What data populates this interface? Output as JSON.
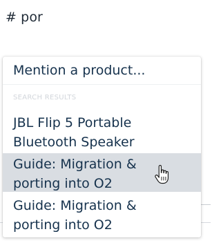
{
  "editor": {
    "text": "# por"
  },
  "dropdown": {
    "mention_label": "Mention a product...",
    "section_header": "SEARCH RESULTS",
    "results": [
      {
        "line1": "JBL Flip 5 Portable",
        "line2": "Bluetooth Speaker",
        "hovered": false
      },
      {
        "line1": "Guide: Migration &",
        "line2": "porting into O2",
        "hovered": true
      },
      {
        "line1": "Guide: Migration &",
        "line2": "porting into O2",
        "hovered": false
      }
    ]
  },
  "colors": {
    "text": "#16324d",
    "hover_background": "#d9dde2",
    "section_header": "#d2d6db"
  },
  "icons": {
    "cursor": "hand-pointer-icon"
  }
}
